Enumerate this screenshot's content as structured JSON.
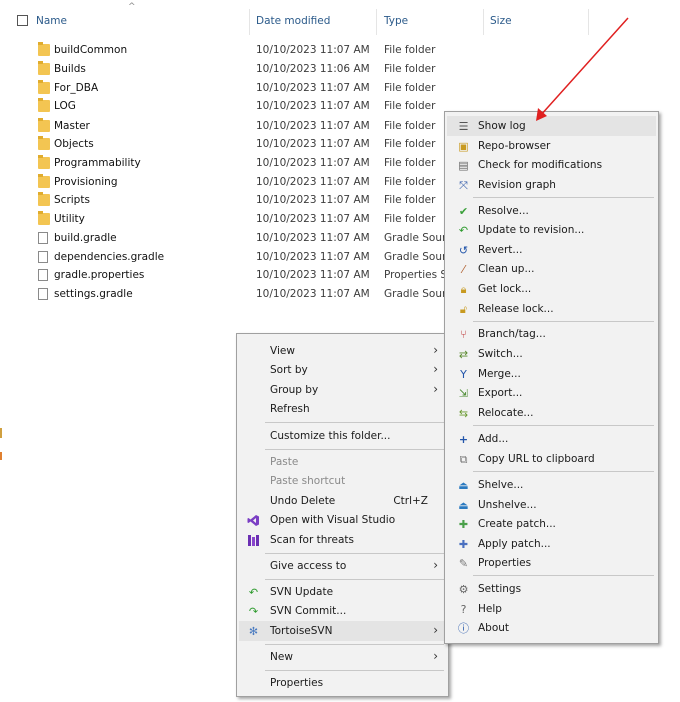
{
  "header": {
    "name_col": "Name",
    "date_col": "Date modified",
    "type_col": "Type",
    "size_col": "Size",
    "sort_caret": "^"
  },
  "files": [
    {
      "name": "buildCommon",
      "date": "10/10/2023 11:07 AM",
      "type": "File folder",
      "kind": "folder"
    },
    {
      "name": "Builds",
      "date": "10/10/2023 11:06 AM",
      "type": "File folder",
      "kind": "folder"
    },
    {
      "name": "For_DBA",
      "date": "10/10/2023 11:07 AM",
      "type": "File folder",
      "kind": "folder"
    },
    {
      "name": "LOG",
      "date": "10/10/2023 11:07 AM",
      "type": "File folder",
      "kind": "folder"
    },
    {
      "name": "Master",
      "date": "10/10/2023 11:07 AM",
      "type": "File folder",
      "kind": "folder"
    },
    {
      "name": "Objects",
      "date": "10/10/2023 11:07 AM",
      "type": "File folder",
      "kind": "folder"
    },
    {
      "name": "Programmability",
      "date": "10/10/2023 11:07 AM",
      "type": "File folder",
      "kind": "folder"
    },
    {
      "name": "Provisioning",
      "date": "10/10/2023 11:07 AM",
      "type": "File folder",
      "kind": "folder"
    },
    {
      "name": "Scripts",
      "date": "10/10/2023 11:07 AM",
      "type": "File folder",
      "kind": "folder"
    },
    {
      "name": "Utility",
      "date": "10/10/2023 11:07 AM",
      "type": "File folder",
      "kind": "folder"
    },
    {
      "name": "build.gradle",
      "date": "10/10/2023 11:07 AM",
      "type": "Gradle Source",
      "kind": "file"
    },
    {
      "name": "dependencies.gradle",
      "date": "10/10/2023 11:07 AM",
      "type": "Gradle Source",
      "kind": "file"
    },
    {
      "name": "gradle.properties",
      "date": "10/10/2023 11:07 AM",
      "type": "Properties Source",
      "kind": "file"
    },
    {
      "name": "settings.gradle",
      "date": "10/10/2023 11:07 AM",
      "type": "Gradle Source",
      "kind": "file"
    }
  ],
  "context_menu": {
    "view": "View",
    "sort_by": "Sort by",
    "group_by": "Group by",
    "refresh": "Refresh",
    "customize": "Customize this folder...",
    "paste": "Paste",
    "paste_shortcut": "Paste shortcut",
    "undo_delete": "Undo Delete",
    "undo_shortcut": "Ctrl+Z",
    "open_vs": "Open with Visual Studio",
    "scan": "Scan for threats",
    "give_access": "Give access to",
    "svn_update": "SVN Update",
    "svn_commit": "SVN Commit...",
    "tortoise": "TortoiseSVN",
    "new": "New",
    "properties": "Properties"
  },
  "svn_menu": {
    "show_log": "Show log",
    "repo_browser": "Repo-browser",
    "check_mods": "Check for modifications",
    "rev_graph": "Revision graph",
    "resolve": "Resolve...",
    "update_rev": "Update to revision...",
    "revert": "Revert...",
    "cleanup": "Clean up...",
    "get_lock": "Get lock...",
    "release_lock": "Release lock...",
    "branch": "Branch/tag...",
    "switch": "Switch...",
    "merge": "Merge...",
    "export": "Export...",
    "relocate": "Relocate...",
    "add": "Add...",
    "copy_url": "Copy URL to clipboard",
    "shelve": "Shelve...",
    "unshelve": "Unshelve...",
    "create_patch": "Create patch...",
    "apply_patch": "Apply patch...",
    "props": "Properties",
    "settings": "Settings",
    "help": "Help",
    "about": "About"
  },
  "arrow_glyph": "›",
  "colors": {
    "annotation_arrow": "#e02020",
    "folder": "#f3c552",
    "highlight": "#e4e4e4"
  }
}
